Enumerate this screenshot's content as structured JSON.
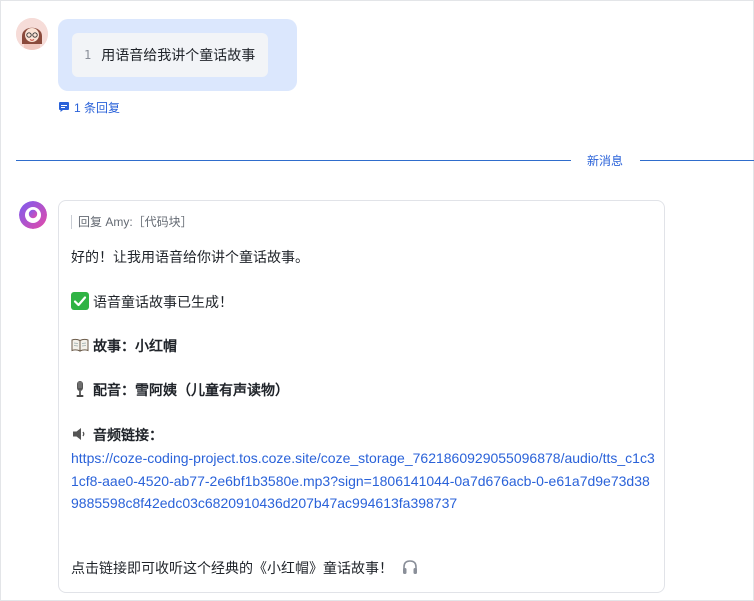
{
  "user_message": {
    "line_number": "1",
    "text": "用语音给我讲个童话故事",
    "reply_count_label": "1 条回复"
  },
  "divider": {
    "label": "新消息"
  },
  "bot_message": {
    "quote": "回复 Amy:［代码块］",
    "intro": "好的！让我用语音给你讲个童话故事。",
    "status": "语音童话故事已生成！",
    "story_label": "故事：小红帽",
    "voice_label": "配音：雪阿姨（儿童有声读物）",
    "link_label": "音频链接：",
    "link": "https://coze-coding-project.tos.coze.site/coze_storage_7621860929055096878/audio/tts_c1c31cf8-aae0-4520-ab77-2e6bf1b3580e.mp3?sign=1806141044-0a7d676acb-0-e61a7d9e73d389885598c8f42edc03c6820910436d207b47ac994613fa398737",
    "closing": "点击链接即可收听这个经典的《小红帽》童话故事！"
  },
  "icons": {
    "user_avatar": "user-avatar",
    "bot_avatar": "bot-avatar-icon",
    "reply": "comment-icon",
    "check": "check-mark-icon",
    "book": "open-book-icon",
    "mic": "microphone-icon",
    "speaker": "speaker-icon",
    "headphones": "headphones-icon"
  },
  "colors": {
    "link": "#2a62d9",
    "bubble": "#dbe7fd",
    "divider": "#2f6dcc",
    "check": "#2fb344"
  }
}
